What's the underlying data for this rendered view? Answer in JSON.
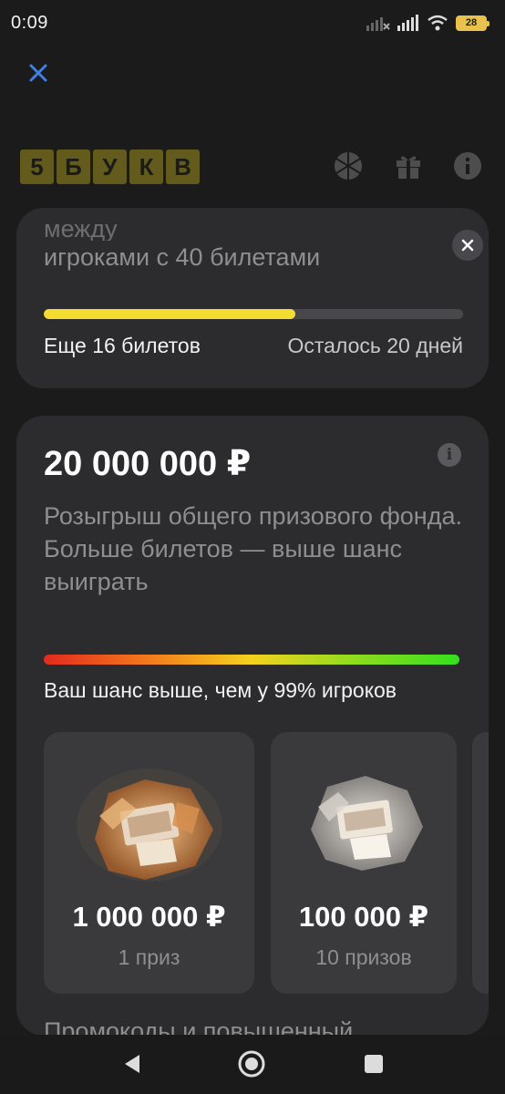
{
  "status": {
    "time": "0:09",
    "battery": "28"
  },
  "logo": {
    "letters": [
      "5",
      "Б",
      "У",
      "К",
      "В"
    ]
  },
  "goal_card": {
    "text_partial": "между",
    "text": "игроками с 40 билетами",
    "progress": 0.6,
    "tickets_left": "Еще 16 билетов",
    "days_left": "Осталось 20 дней"
  },
  "prize_card": {
    "title": "20 000 000 ₽",
    "description_line1": "Розыгрыш общего призового фонда.",
    "description_line2": "Больше билетов — выше шанс выиграть",
    "chance_text": "Ваш шанс выше, чем у 99% игроков",
    "prizes": [
      {
        "amount": "1 000 000 ₽",
        "count": "1 приз"
      },
      {
        "amount": "100 000 ₽",
        "count": "10 призов"
      }
    ],
    "promo_partial": "Промокоды и повышенный"
  },
  "colors": {
    "accent_yellow": "#f5dc30",
    "card_bg": "#2c2c2e",
    "close_blue": "#3f7fe6"
  },
  "icons": [
    "close-icon",
    "wheel-icon",
    "gift-icon",
    "info-icon",
    "back-icon",
    "home-icon",
    "recents-icon"
  ]
}
